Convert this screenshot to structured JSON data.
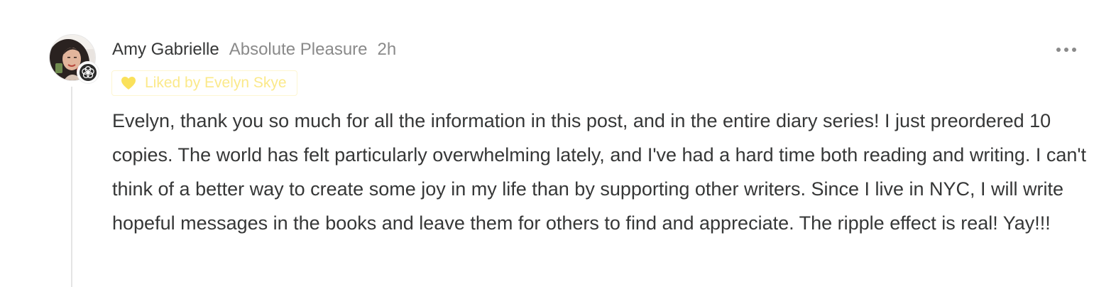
{
  "comment": {
    "author": "Amy Gabrielle",
    "publication": "Absolute Pleasure",
    "time": "2h",
    "liked_by": "Liked by Evelyn Skye",
    "body": "Evelyn, thank you so much for all the information in this post, and in the entire diary series! I just preordered 10 copies. The world has felt particularly overwhelming lately, and I've had a hard time both reading and writing. I can't think of a better way to create some joy in my life than by supporting other writers. Since I live in NYC, I will write hopeful messages in the books and leave them for others to find and appreciate. The ripple effect is real! Yay!!!"
  },
  "icons": {
    "avatar": "profile-photo",
    "badge": "flower-badge-icon",
    "liked": "heart-icon",
    "more": "more-options-icon"
  },
  "colors": {
    "text": "#363737",
    "muted": "#8a8a8a",
    "liked_text": "#fbe98a",
    "liked_heart": "#fae15b",
    "liked_border": "#fdf6d2",
    "thread_line": "#e4e4e4"
  }
}
